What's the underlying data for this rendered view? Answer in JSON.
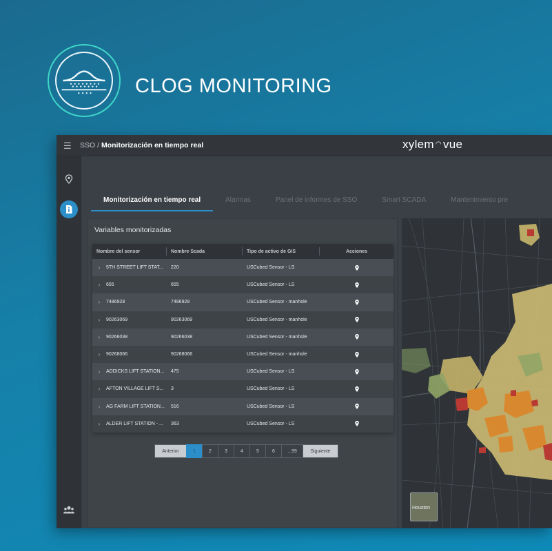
{
  "hero": {
    "title": "CLOG MONITORING",
    "logo_icon": "sewer-pipe-clog-icon"
  },
  "app": {
    "brand": "xylem",
    "brand_suffix": "vue",
    "breadcrumb": {
      "root": "SSO",
      "separator": "/",
      "current": "Monitorización en tiempo real"
    },
    "nav_icons": [
      "map-pin-icon",
      "report-icon",
      "users-icon"
    ],
    "colors": {
      "accent": "#2c8fc9",
      "topbar": "#32363b",
      "panel": "#3f4449"
    }
  },
  "tabs": [
    {
      "label": "Monitorización en tiempo real",
      "active": true
    },
    {
      "label": "Alarmas",
      "active": false
    },
    {
      "label": "Panel de informes de SSO",
      "active": false
    },
    {
      "label": "Smart SCADA",
      "active": false
    },
    {
      "label": "Mantenimiento pre",
      "active": false
    }
  ],
  "panel": {
    "title": "Variables monitorizadas",
    "columns": [
      "Nombre del sensor",
      "Nombre Scada",
      "Tipo de activo de GIS",
      "Acciones"
    ],
    "rows": [
      {
        "sensor": "5TH STREET LIFT STAT...",
        "scada": "220",
        "gis": "USCubed Sensor - LS"
      },
      {
        "sensor": "655",
        "scada": "655",
        "gis": "USCubed Sensor - LS"
      },
      {
        "sensor": "7486928",
        "scada": "7486928",
        "gis": "USCubed Sensor - manhole"
      },
      {
        "sensor": "90263069",
        "scada": "90263069",
        "gis": "USCubed Sensor - manhole"
      },
      {
        "sensor": "90266038",
        "scada": "90266038",
        "gis": "USCubed Sensor - manhole"
      },
      {
        "sensor": "90268066",
        "scada": "90268066",
        "gis": "USCubed Sensor - manhole"
      },
      {
        "sensor": "ADDICKS LIFT STATION...",
        "scada": "475",
        "gis": "USCubed Sensor - LS"
      },
      {
        "sensor": "AFTON VILLAGE LIFT S...",
        "scada": "3",
        "gis": "USCubed Sensor - LS"
      },
      {
        "sensor": "AG FARM LIFT STATION...",
        "scada": "516",
        "gis": "USCubed Sensor - LS"
      },
      {
        "sensor": "ALDER LIFT STATION - ...",
        "scada": "363",
        "gis": "USCubed Sensor - LS"
      }
    ],
    "pagination": {
      "prev": "Anterior",
      "pages": [
        "1",
        "2",
        "3",
        "4",
        "5",
        "6",
        "...99"
      ],
      "current": "1",
      "next": "Siguiente"
    }
  },
  "map": {
    "thumbnail_label": "Houston"
  }
}
